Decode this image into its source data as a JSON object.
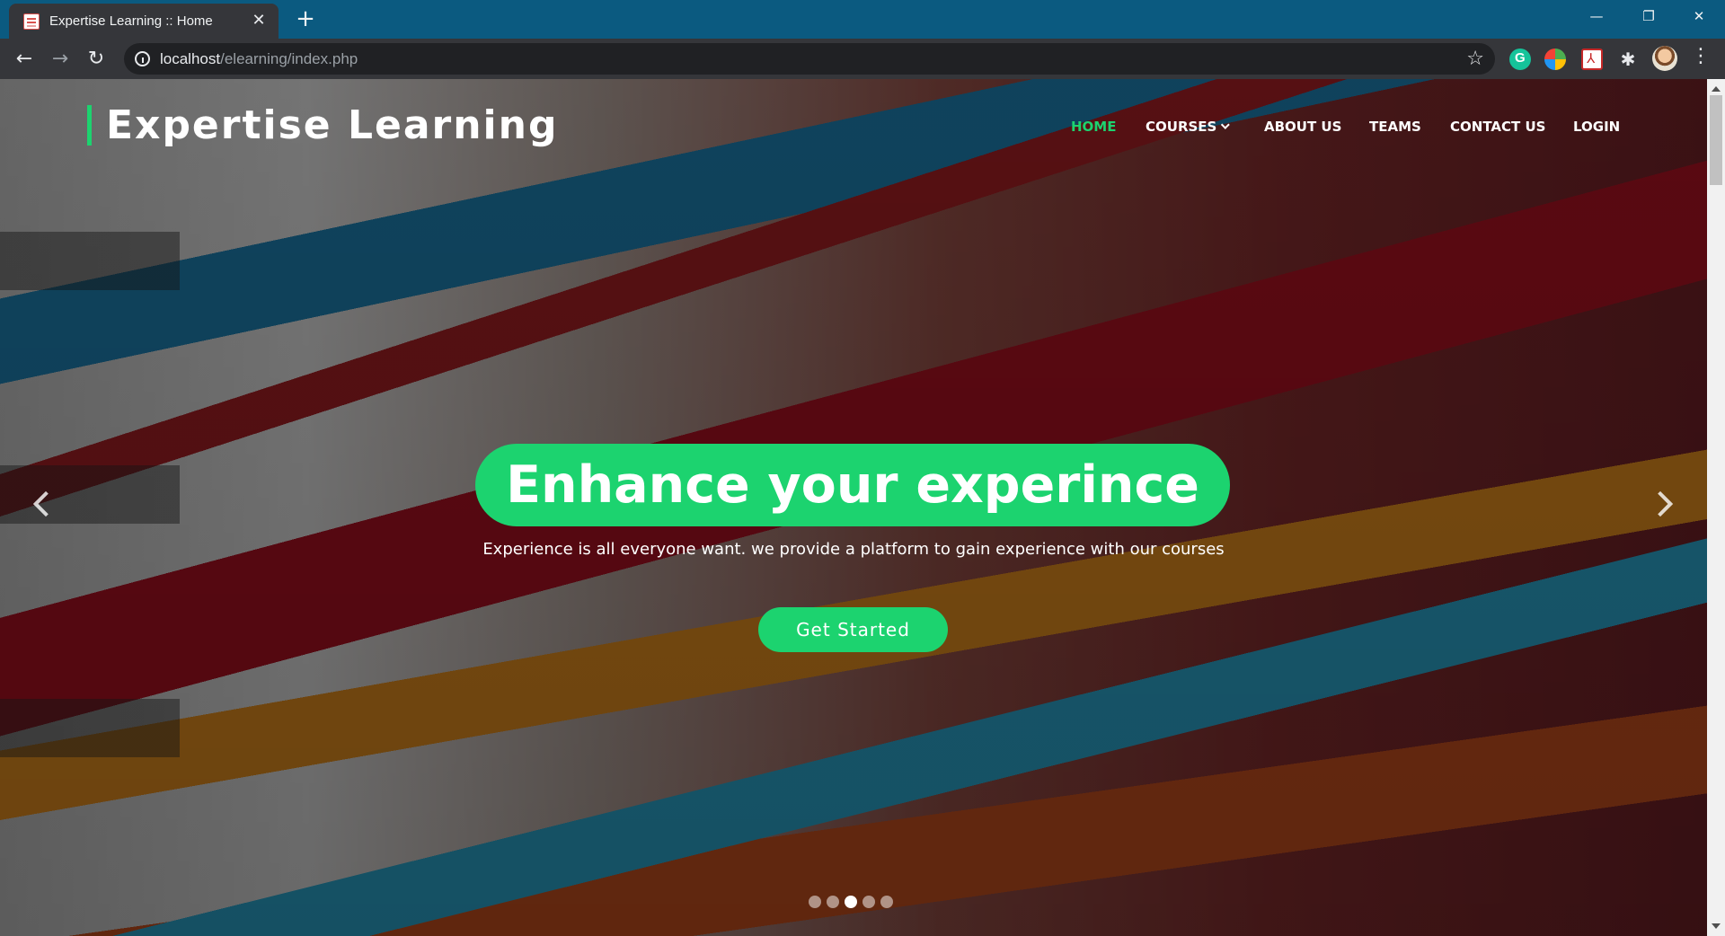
{
  "browser": {
    "tab_title": "Expertise Learning :: Home",
    "tab_close": "✕",
    "new_tab": "+",
    "url_host": "localhost",
    "url_path": "/elearning/index.php",
    "window_controls": {
      "minimize": "—",
      "restore": "❐",
      "close": "✕"
    },
    "nav": {
      "back": "←",
      "forward": "→",
      "reload": "↻"
    },
    "star": "☆",
    "puzzle": "✱",
    "menu": "⋮",
    "icons": [
      "favicon",
      "info-icon",
      "star-icon",
      "grammarly-icon",
      "globe-extension-icon",
      "pdf-extension-icon",
      "puzzle-icon",
      "avatar",
      "kebab-menu-icon"
    ]
  },
  "site": {
    "brand": "Expertise Learning",
    "accent_color": "#1cd36f",
    "nav": [
      {
        "label": "HOME",
        "active": true
      },
      {
        "label": "COURSES",
        "active": false,
        "dropdown": true
      },
      {
        "label": "ABOUT US",
        "active": false
      },
      {
        "label": "TEAMS",
        "active": false
      },
      {
        "label": "CONTACT US",
        "active": false
      },
      {
        "label": "LOGIN",
        "active": false
      }
    ]
  },
  "hero": {
    "title": "Enhance your experince",
    "subtitle": "Experience is all everyone want. we provide a platform to gain experience with our courses",
    "cta_label": "Get Started",
    "slide_count": 5,
    "active_slide": 3
  }
}
